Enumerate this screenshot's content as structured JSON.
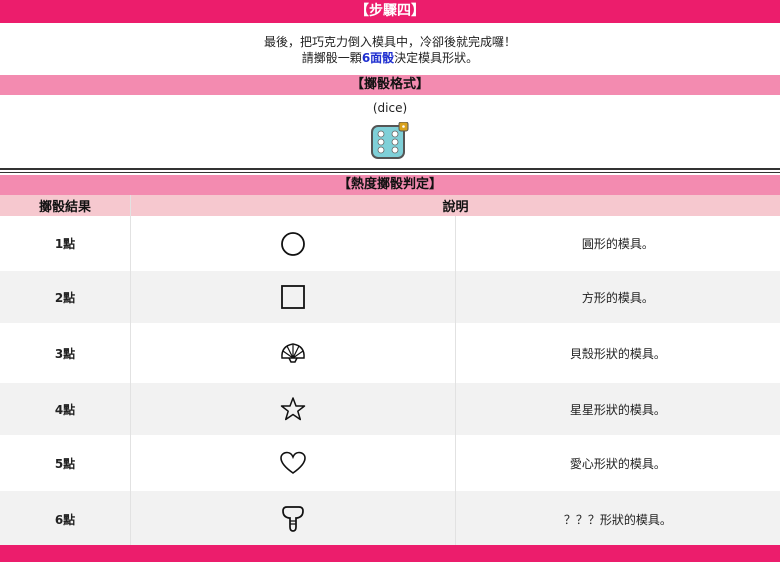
{
  "step_title": "【步驟四】",
  "intro": {
    "line1": "最後，把巧克力倒入模具中，冷卻後就完成囉！",
    "line2_pre": "請擲骰一顆",
    "line2_highlight": "6面骰",
    "line2_post": "決定模具形狀。"
  },
  "dice_format": {
    "title": "【擲骰格式】",
    "code": "(dice)",
    "icon": "dice-icon"
  },
  "judge_title": "【熱度擲骰判定】",
  "table": {
    "headers": [
      "擲骰結果",
      "說明"
    ],
    "rows": [
      {
        "result": "1點",
        "icon": "circle-icon",
        "desc": "圓形的模具。"
      },
      {
        "result": "2點",
        "icon": "square-icon",
        "desc": "方形的模具。"
      },
      {
        "result": "3點",
        "icon": "shell-icon",
        "desc": "貝殼形狀的模具。"
      },
      {
        "result": "4點",
        "icon": "star-icon",
        "desc": "星星形狀的模具。"
      },
      {
        "result": "5點",
        "icon": "heart-icon",
        "desc": "愛心形狀的模具。"
      },
      {
        "result": "6點",
        "icon": "mystery-shape-icon",
        "desc": "？？？形狀的模具。"
      }
    ]
  },
  "colors": {
    "header_bar": "#ec1d6c",
    "section_bar": "#f38bb0",
    "table_header": "#f6c8cf",
    "highlight_text": "#1f2fd0"
  }
}
